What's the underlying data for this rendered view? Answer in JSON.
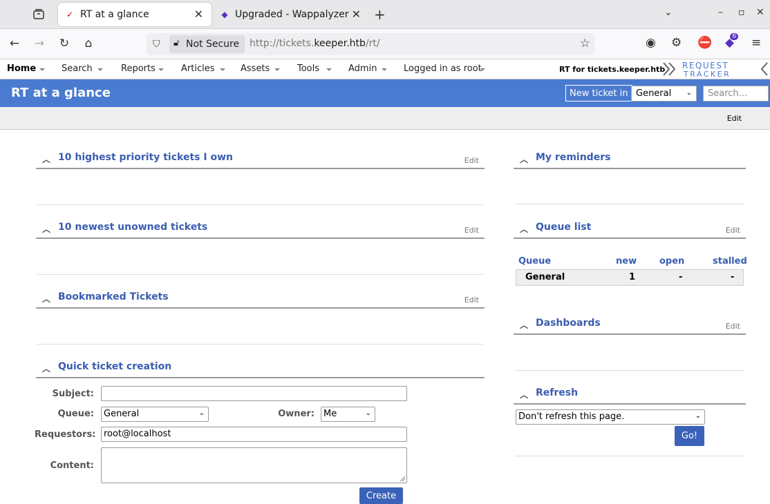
{
  "browser": {
    "tabs": [
      {
        "title": "RT at a glance"
      },
      {
        "title": "Upgraded - Wappalyzer"
      }
    ],
    "not_secure": "Not Secure",
    "url_prefix": "http://tickets.",
    "url_host": "keeper.htb",
    "url_path": "/rt/",
    "extension_badge": "6"
  },
  "menu": {
    "items": [
      "Home",
      "Search",
      "Reports",
      "Articles",
      "Assets",
      "Tools",
      "Admin",
      "Logged in as root"
    ],
    "rt_for": "RT for tickets.keeper.htb",
    "logo_top": "REQUEST",
    "logo_bottom": "TRACKER"
  },
  "header": {
    "title": "RT at a glance",
    "new_ticket_label": "New ticket in",
    "queue_value": "General",
    "search_placeholder": "Search..."
  },
  "subbar": {
    "edit_label": "Edit"
  },
  "widgets": {
    "priority": {
      "title": "10 highest priority tickets I own",
      "edit": "Edit"
    },
    "unowned": {
      "title": "10 newest unowned tickets",
      "edit": "Edit"
    },
    "bookmarked": {
      "title": "Bookmarked Tickets",
      "edit": "Edit"
    },
    "quick": {
      "title": "Quick ticket creation"
    },
    "reminders": {
      "title": "My reminders"
    },
    "queuelist": {
      "title": "Queue list",
      "edit": "Edit"
    },
    "dashboards": {
      "title": "Dashboards",
      "edit": "Edit"
    },
    "refresh": {
      "title": "Refresh"
    }
  },
  "queue_table": {
    "headers": [
      "Queue",
      "new",
      "open",
      "stalled"
    ],
    "rows": [
      {
        "queue": "General",
        "new": "1",
        "open": "-",
        "stalled": "-"
      }
    ]
  },
  "quick_form": {
    "subject_label": "Subject:",
    "subject_value": "",
    "queue_label": "Queue:",
    "queue_value": "General",
    "owner_label": "Owner:",
    "owner_value": "Me",
    "requestors_label": "Requestors:",
    "requestors_value": "root@localhost",
    "content_label": "Content:",
    "create_label": "Create"
  },
  "refresh_form": {
    "select_value": "Don't refresh this page.",
    "go_label": "Go!"
  }
}
